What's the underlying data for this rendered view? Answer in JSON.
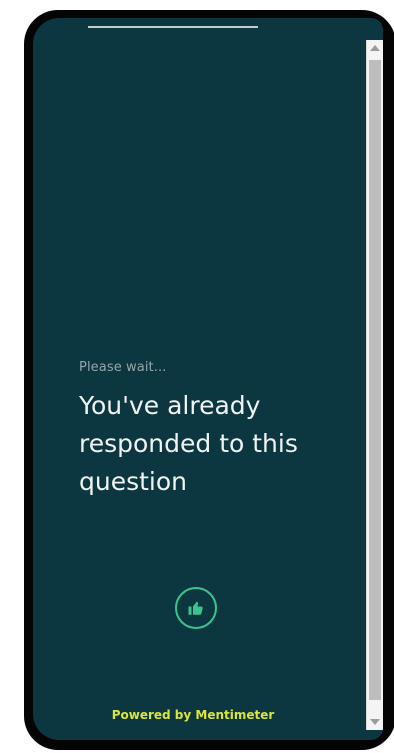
{
  "screen": {
    "status_text": "Please wait...",
    "headline": "You've already responded to this question",
    "footer": "Powered by Mentimeter"
  },
  "icons": {
    "reaction": "thumbs-up-icon"
  },
  "colors": {
    "background": "#0c3640",
    "accent": "#39c58b",
    "footer_text": "#dbe53c"
  }
}
